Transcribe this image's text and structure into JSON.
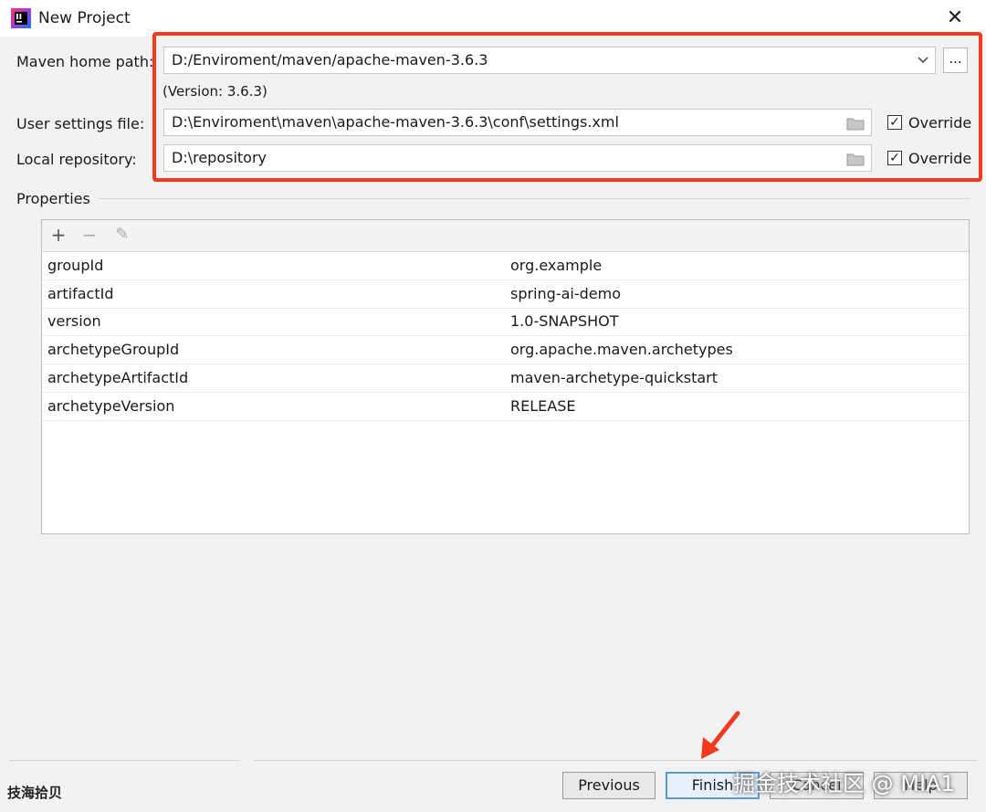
{
  "window": {
    "title": "New Project",
    "close_symbol": "✕"
  },
  "maven": {
    "home_label": "Maven home path:",
    "home_value": "D:/Enviroment/maven/apache-maven-3.6.3",
    "browse_label": "...",
    "version_text": "(Version: 3.6.3)",
    "settings_label": "User settings file:",
    "settings_value": "D:\\Enviroment\\maven\\apache-maven-3.6.3\\conf\\settings.xml",
    "settings_override": "Override",
    "repo_label": "Local repository:",
    "repo_value": "D:\\repository",
    "repo_override": "Override",
    "settings_override_checked": true,
    "repo_override_checked": true
  },
  "properties": {
    "section_title": "Properties",
    "toolbar": {
      "add": "+",
      "remove": "−",
      "edit": "✎"
    },
    "rows": [
      {
        "key": "groupId",
        "value": "org.example"
      },
      {
        "key": "artifactId",
        "value": "spring-ai-demo"
      },
      {
        "key": "version",
        "value": "1.0-SNAPSHOT"
      },
      {
        "key": "archetypeGroupId",
        "value": "org.apache.maven.archetypes"
      },
      {
        "key": "archetypeArtifactId",
        "value": "maven-archetype-quickstart"
      },
      {
        "key": "archetypeVersion",
        "value": "RELEASE"
      }
    ]
  },
  "footer": {
    "previous": "Previous",
    "finish": "Finish",
    "cancel": "Cancel",
    "help": "Help"
  },
  "watermarks": {
    "left": "技海拾贝",
    "right": "掘金技术社区 @ MIA1"
  },
  "colors": {
    "highlight": "#f23a1f",
    "arrow": "#f23a1f",
    "default_button_border": "#5b9bd5"
  }
}
